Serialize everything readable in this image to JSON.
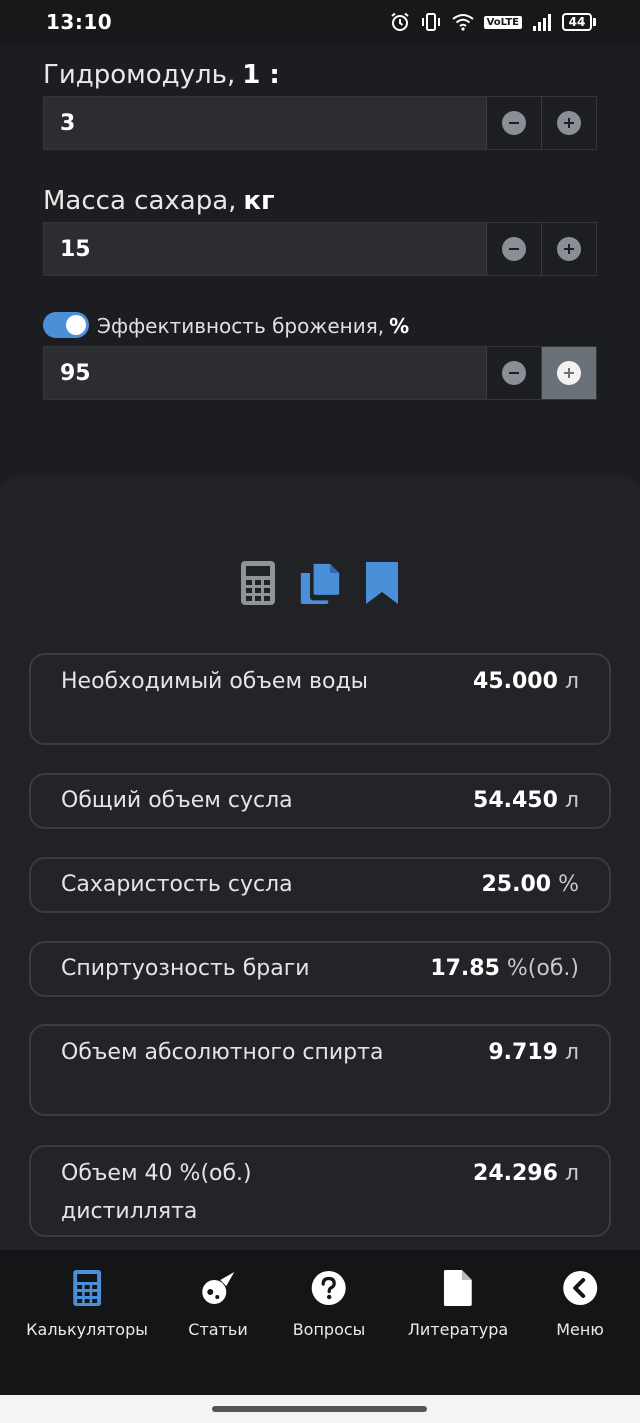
{
  "status_bar": {
    "time": "13:10",
    "network": "VoLTE",
    "battery": "44",
    "icons": [
      "alarm-icon",
      "vibrate-icon",
      "wifi-icon",
      "volte-icon",
      "signal-icon",
      "battery-icon"
    ]
  },
  "form": {
    "hydromodule": {
      "label": "Гидромодуль,",
      "label_bold": "1 :",
      "value": "3"
    },
    "sugar_mass": {
      "label": "Масса сахара,",
      "label_bold": "кг",
      "value": "15"
    },
    "efficiency": {
      "label": "Эффективность брожения,",
      "label_bold": "%",
      "value": "95",
      "toggle_on": true
    }
  },
  "toolbar": {
    "icons": [
      "calculator-icon",
      "copy-icon",
      "bookmark-icon"
    ]
  },
  "results": [
    {
      "label": "Необходимый объем воды",
      "value": "45.000",
      "unit": "л"
    },
    {
      "label": "Общий объем сусла",
      "value": "54.450",
      "unit": "л"
    },
    {
      "label": "Сахаристость сусла",
      "value": "25.00",
      "unit": "%"
    },
    {
      "label": "Спиртуозность браги",
      "value": "17.85",
      "unit": "%(об.)"
    },
    {
      "label": "Объем абсолютного спирта",
      "value": "9.719",
      "unit": "л"
    },
    {
      "label": "Объем 40 %(об.) дистиллята",
      "value": "24.296",
      "unit": "л"
    }
  ],
  "nav": {
    "items": [
      {
        "label": "Калькуляторы",
        "icon": "calculator-icon"
      },
      {
        "label": "Статьи",
        "icon": "comet-icon"
      },
      {
        "label": "Вопросы",
        "icon": "question-icon"
      },
      {
        "label": "Литература",
        "icon": "document-icon"
      },
      {
        "label": "Меню",
        "icon": "chevron-left-icon"
      }
    ]
  },
  "colors": {
    "accent": "#4a90d9",
    "background": "#1c1d20",
    "panel": "#202226"
  }
}
